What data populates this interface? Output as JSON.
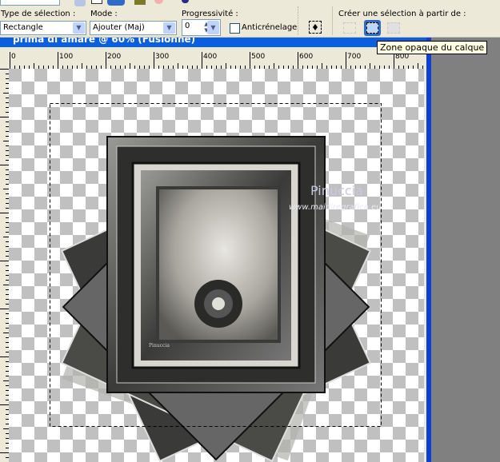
{
  "toolbar": {
    "selection_type_label": "Type de sélection :",
    "selection_type_value": "Rectangle",
    "mode_label": "Mode :",
    "mode_value": "Ajouter (Maj)",
    "feather_label": "Progressivité :",
    "feather_value": "0",
    "antialias_label": "Anticrénelage",
    "antialias_checked": false,
    "create_from_label": "Créer une sélection à partir de :",
    "create_from_icons": [
      "selection-from-mask-icon",
      "opaque-layer-icon",
      "selection-from-vector-icon"
    ],
    "active_create_from": "opaque-layer-icon"
  },
  "tooltip": "Zone opaque du calque",
  "document": {
    "title": "prima di amare @ 60% (Fusionné)",
    "zoom_percent": 60,
    "ruler_labels": [
      "0",
      "100",
      "200",
      "300",
      "400",
      "500",
      "600",
      "700",
      "800"
    ]
  },
  "artwork": {
    "watermark_name": "Pinuccia",
    "watermark_url": "www.maidiregrafica.eu",
    "signature": "Pinuccia"
  },
  "colors": {
    "titlebar": "#0a5fe0",
    "toolbar_bg": "#ece9d8",
    "active_button": "#316ac5"
  }
}
